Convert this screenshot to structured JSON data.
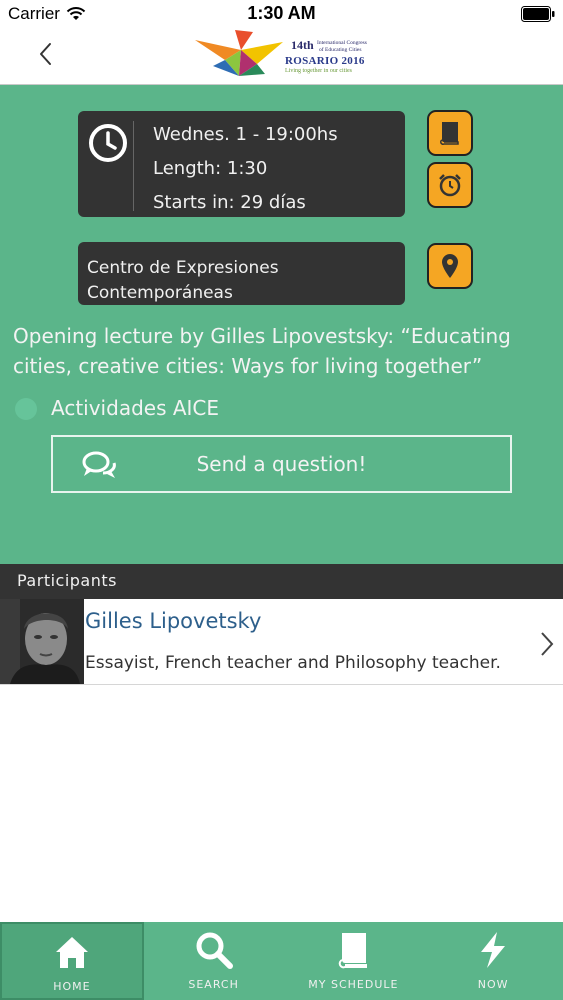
{
  "status_bar": {
    "carrier": "Carrier",
    "time": "1:30 AM"
  },
  "header": {
    "logo": {
      "title": "14th",
      "subtitle_line1": "International Congress",
      "subtitle_line2": "of Educating Cities",
      "city": "ROSARIO 2016",
      "tagline": "Living together in our cities"
    }
  },
  "event": {
    "day_time": "Wednes. 1 - 19:00hs",
    "length": "Length: 1:30",
    "starts_in": "Starts in: 29 días",
    "venue": "Centro de Expresiones Contemporáneas",
    "title": "Opening lecture by Gilles Lipovestsky: “Educating cities, creative cities: Ways for living together”",
    "category": "Actividades AICE",
    "question_button": "Send a question!"
  },
  "participants": {
    "header": "Participants",
    "items": [
      {
        "name": "Gilles Lipovetsky",
        "bio": "Essayist, French teacher and Philosophy teacher."
      }
    ]
  },
  "tab_bar": {
    "tabs": [
      {
        "label": "HOME",
        "icon": "home-icon",
        "active": true
      },
      {
        "label": "SEARCH",
        "icon": "search-icon",
        "active": false
      },
      {
        "label": "MY SCHEDULE",
        "icon": "book-icon",
        "active": false
      },
      {
        "label": "NOW",
        "icon": "lightning-icon",
        "active": false
      }
    ]
  },
  "colors": {
    "green": "#5bb58a",
    "dark": "#333333",
    "orange": "#f5a623",
    "name_blue": "#2d5f8b"
  }
}
